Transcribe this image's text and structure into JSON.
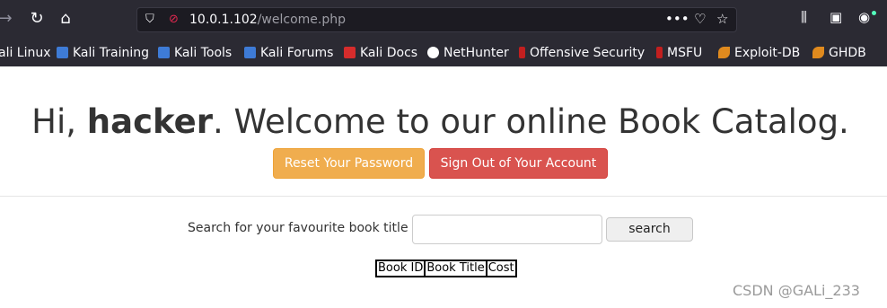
{
  "browser": {
    "url_host": "10.0.1.102",
    "url_path": "/welcome.php"
  },
  "bookmarks": [
    {
      "label": "ali Linux",
      "icon": "kali-icon"
    },
    {
      "label": "Kali Training",
      "icon": "kali-training-icon"
    },
    {
      "label": "Kali Tools",
      "icon": "kali-tools-icon"
    },
    {
      "label": "Kali Forums",
      "icon": "kali-forums-icon"
    },
    {
      "label": "Kali Docs",
      "icon": "kali-docs-icon"
    },
    {
      "label": "NetHunter",
      "icon": "nethunter-icon"
    },
    {
      "label": "Offensive Security",
      "icon": "offsec-icon"
    },
    {
      "label": "MSFU",
      "icon": "msfu-icon"
    },
    {
      "label": "Exploit-DB",
      "icon": "exploitdb-icon"
    },
    {
      "label": "GHDB",
      "icon": "ghdb-icon"
    }
  ],
  "page": {
    "greeting_prefix": "Hi, ",
    "username": "hacker",
    "greeting_suffix": ". Welcome to our online Book Catalog.",
    "reset_button": "Reset Your Password",
    "signout_button": "Sign Out of Your Account",
    "search_label": "Search for your favourite book title",
    "search_value": "",
    "search_button": "search",
    "table_headers": [
      "Book ID",
      "Book Title",
      "Cost"
    ]
  },
  "watermark": "CSDN @GALi_233",
  "colors": {
    "warning": "#f0ad4e",
    "danger": "#d9534f",
    "toolbar_bg": "#2b2a33"
  }
}
